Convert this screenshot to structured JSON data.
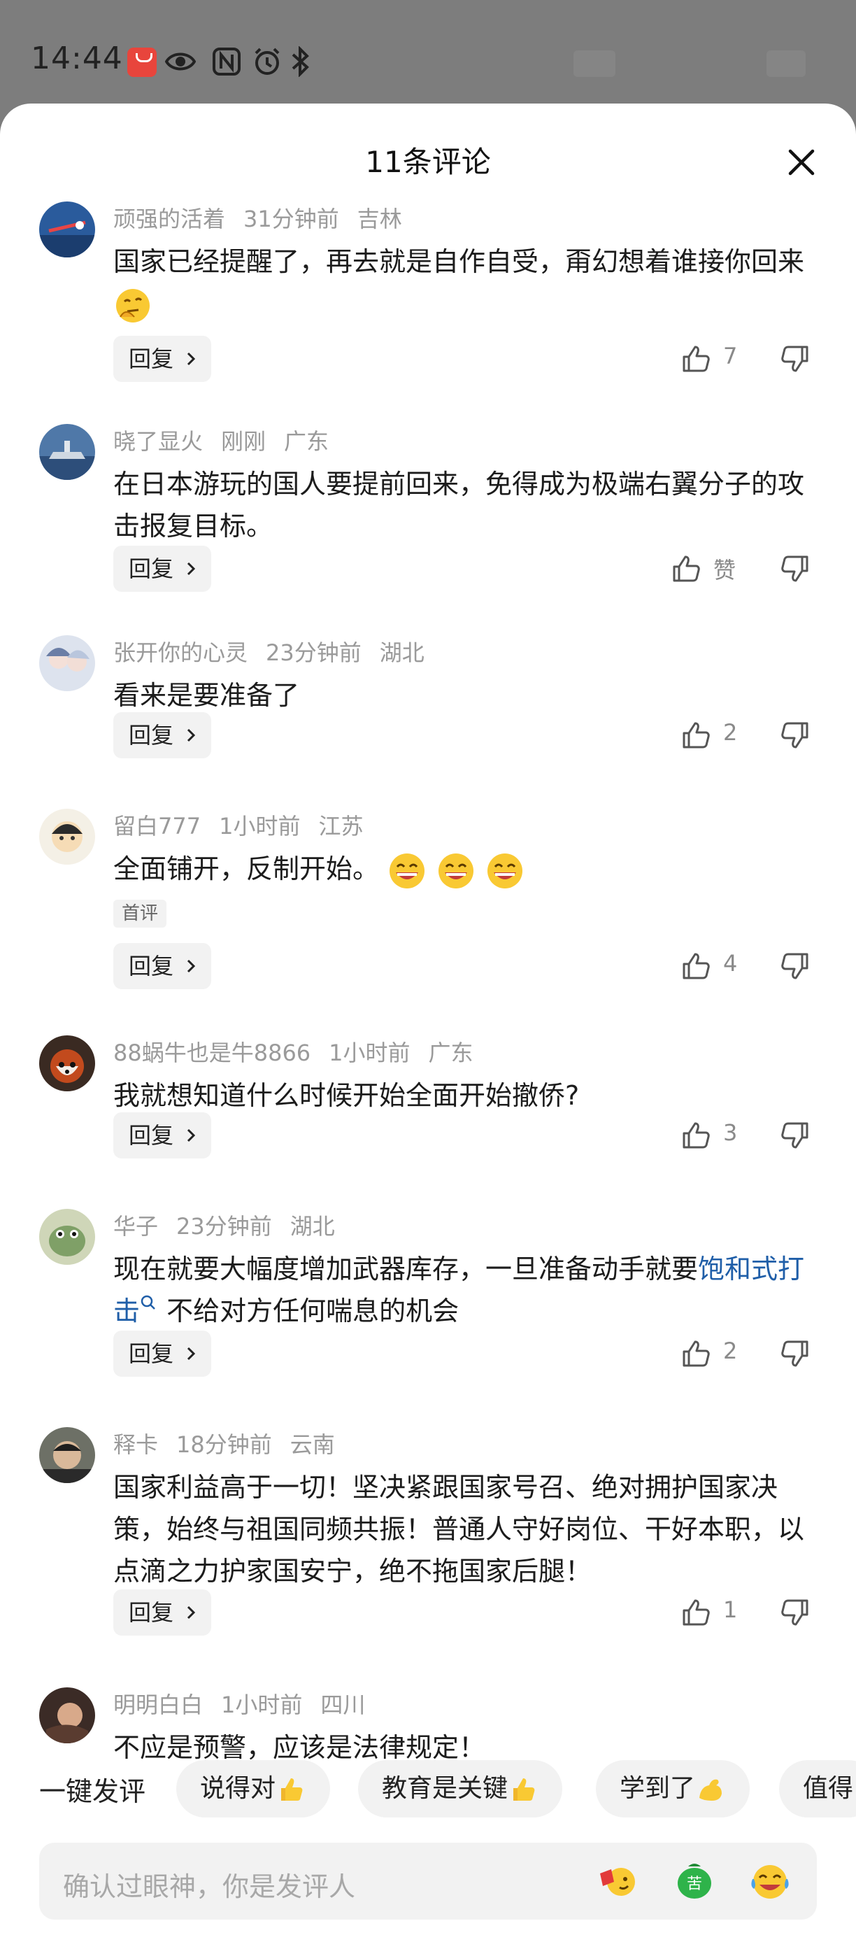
{
  "status_bar": {
    "time": "14:44",
    "icons": [
      "huawei-icon",
      "eye-icon",
      "nfc-icon",
      "alarm-icon",
      "bluetooth-icon"
    ]
  },
  "sheet": {
    "title": "11条评论",
    "close_icon": "close-icon"
  },
  "comments": [
    {
      "user": "顽强的活着",
      "time": "31分钟前",
      "location": "吉林",
      "text": "国家已经提醒了，再去就是自作自受，甭幻想着谁接你回来",
      "emoji": "thinking-face",
      "reply_label": "回复",
      "likes": "7"
    },
    {
      "user": "晓了显火",
      "time": "刚刚",
      "location": "广东",
      "text": "在日本游玩的国人要提前回来，免得成为极端右翼分子的攻击报复目标。",
      "reply_label": "回复",
      "likes": "赞"
    },
    {
      "user": "张开你的心灵",
      "time": "23分钟前",
      "location": "湖北",
      "text": "看来是要准备了",
      "reply_label": "回复",
      "likes": "2"
    },
    {
      "user": "留白777",
      "time": "1小时前",
      "location": "江苏",
      "text": "全面铺开，反制开始。",
      "emoji": "grinning-face x3",
      "tag": "首评",
      "reply_label": "回复",
      "likes": "4"
    },
    {
      "user": "88蜗牛也是牛8866",
      "time": "1小时前",
      "location": "广东",
      "text": "我就想知道什么时候开始全面开始撤侨?",
      "reply_label": "回复",
      "likes": "3"
    },
    {
      "user": "华子",
      "time": "23分钟前",
      "location": "湖北",
      "text_before": "现在就要大幅度增加武器库存，一旦准备动手就要",
      "link": "饱和式打击",
      "text_after": "不给对方任何喘息的机会",
      "reply_label": "回复",
      "likes": "2"
    },
    {
      "user": "释卡",
      "time": "18分钟前",
      "location": "云南",
      "text": "国家利益高于一切！坚决紧跟国家号召、绝对拥护国家决策，始终与祖国同频共振！普通人守好岗位、干好本职，以点滴之力护家国安宁，绝不拖国家后腿！",
      "reply_label": "回复",
      "likes": "1"
    },
    {
      "user": "明明白白",
      "time": "1小时前",
      "location": "四川",
      "text": "不应是预警，应该是法律规定！"
    }
  ],
  "quick_reply": {
    "label": "一键发评",
    "chips": [
      "说得对",
      "教育是关键",
      "学到了",
      "值得"
    ]
  },
  "input": {
    "placeholder": "确认过眼神，你是发评人",
    "emoji_buttons": [
      "sticker-icon",
      "bitter-icon",
      "laughing-crying-icon"
    ]
  }
}
